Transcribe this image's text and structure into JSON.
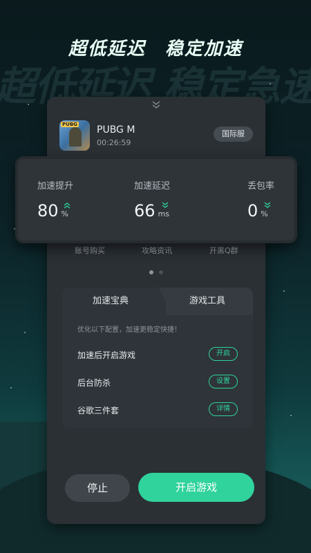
{
  "header": {
    "title_left": "超低延迟",
    "title_right": "稳定加速",
    "ghost_text": "超低延迟 稳定急速"
  },
  "game": {
    "icon_name": "pubg-game-icon",
    "icon_badge": "PUBG",
    "name": "PUBG M",
    "elapsed": "00:26:59",
    "server": "国际服"
  },
  "stats": [
    {
      "label": "加速提升",
      "value": "80",
      "unit": "%",
      "arrow": "up"
    },
    {
      "label": "加速延迟",
      "value": "66",
      "unit": "ms",
      "arrow": "down"
    },
    {
      "label": "丢包率",
      "value": "0",
      "unit": "%",
      "arrow": "down"
    }
  ],
  "links": [
    "账号购买",
    "攻略资讯",
    "开黑Q群"
  ],
  "pager": {
    "count": 2,
    "active": 0
  },
  "panel": {
    "tabs": [
      "加速宝典",
      "游戏工具"
    ],
    "hint": "优化以下配置，加速更稳定快捷！",
    "rows": [
      {
        "label": "加速后开启游戏",
        "button": "开启"
      },
      {
        "label": "后台防杀",
        "button": "设置"
      },
      {
        "label": "谷歌三件套",
        "button": "详情"
      }
    ]
  },
  "actions": {
    "stop": "停止",
    "start": "开启游戏"
  },
  "colors": {
    "accent": "#30d39c",
    "card": "#2b3035"
  }
}
